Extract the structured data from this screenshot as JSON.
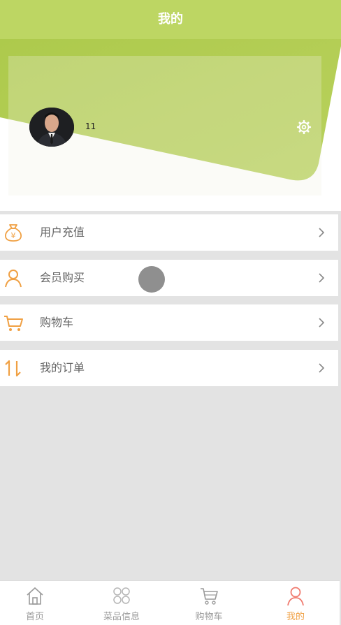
{
  "header": {
    "title": "我的"
  },
  "profile": {
    "username": "11"
  },
  "menu": [
    {
      "label": "用户充值",
      "icon": "money-bag-icon"
    },
    {
      "label": "会员购买",
      "icon": "user-icon"
    },
    {
      "label": "购物车",
      "icon": "cart-icon"
    },
    {
      "label": "我的订单",
      "icon": "sort-arrows-icon"
    }
  ],
  "tabbar": [
    {
      "label": "首页",
      "icon": "home-icon"
    },
    {
      "label": "菜品信息",
      "icon": "grid-icon"
    },
    {
      "label": "购物车",
      "icon": "cart-icon"
    },
    {
      "label": "我的",
      "icon": "user-icon",
      "active": true
    }
  ],
  "colors": {
    "accent_green": "#bdd663",
    "accent_orange": "#f0a043",
    "background": "#e3e3e3"
  }
}
